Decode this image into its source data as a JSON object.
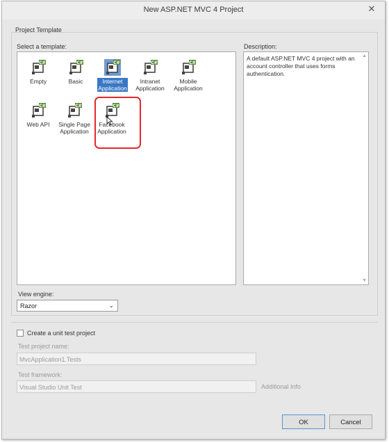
{
  "window": {
    "title": "New ASP.NET MVC 4 Project",
    "close_glyph": "✕"
  },
  "project_template": {
    "group_label": "Project Template",
    "select_label": "Select a template:",
    "templates": [
      {
        "line1": "Empty",
        "line2": "",
        "icon": "csharp-project-icon",
        "selected": false
      },
      {
        "line1": "Basic",
        "line2": "",
        "icon": "csharp-project-icon",
        "selected": false
      },
      {
        "line1": "Internet",
        "line2": "Application",
        "icon": "csharp-project-icon",
        "selected": true
      },
      {
        "line1": "Intranet",
        "line2": "Application",
        "icon": "csharp-project-icon",
        "selected": false
      },
      {
        "line1": "Mobile",
        "line2": "Application",
        "icon": "csharp-project-icon",
        "selected": false
      },
      {
        "line1": "Web API",
        "line2": "",
        "icon": "csharp-project-icon",
        "selected": false
      },
      {
        "line1": "Single Page",
        "line2": "Application",
        "icon": "csharp-project-icon",
        "selected": false
      },
      {
        "line1": "Facebook",
        "line2": "Application",
        "icon": "csharp-project-icon",
        "selected": false
      }
    ],
    "highlight_color": "#e3262b",
    "selection_color": "#3a78c4",
    "description_label": "Description:",
    "description": "A default ASP.NET MVC 4 project with an account controller that uses forms authentication."
  },
  "view_engine": {
    "label": "View engine:",
    "value": "Razor"
  },
  "unit_test": {
    "checkbox_label": "Create a unit test project",
    "checked": false,
    "project_name_label": "Test project name:",
    "project_name_value": "MvcApplication1.Tests",
    "framework_label": "Test framework:",
    "framework_value": "Visual Studio Unit Test",
    "additional_info": "Additional Info"
  },
  "buttons": {
    "ok": "OK",
    "cancel": "Cancel"
  }
}
